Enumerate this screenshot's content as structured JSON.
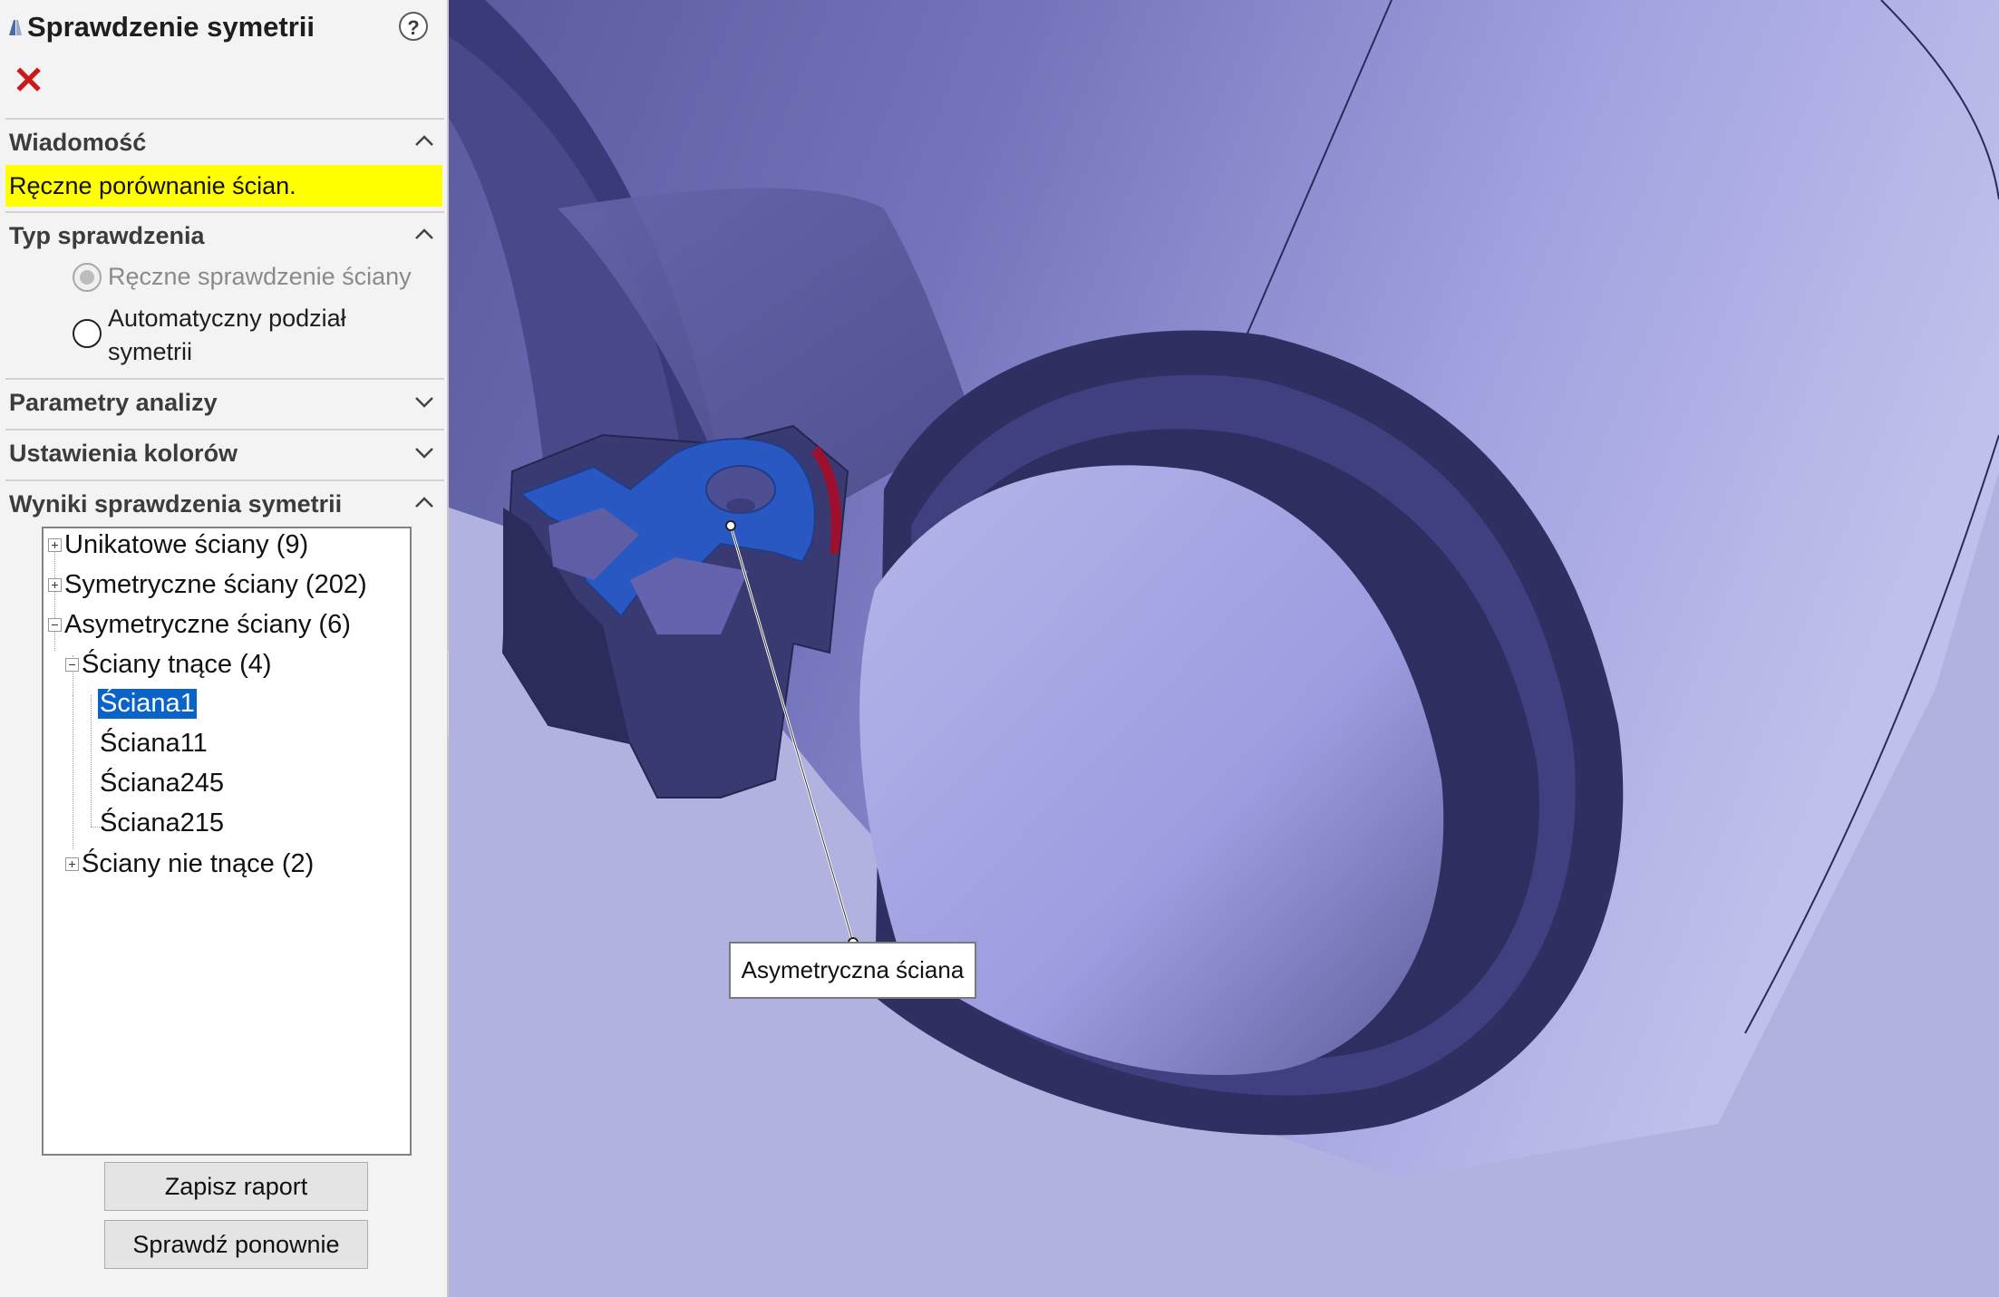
{
  "panel": {
    "title": "Sprawdzenie symetrii",
    "help_label": "?",
    "close_label": "✕",
    "sections": {
      "message": {
        "title": "Wiadomość",
        "text": "Ręczne porównanie ścian."
      },
      "check_type": {
        "title": "Typ sprawdzenia",
        "options": [
          {
            "label": "Ręczne sprawdzenie ściany",
            "selected": true,
            "enabled": false
          },
          {
            "label_line1": "Automatyczny podział",
            "label_line2": "symetrii",
            "selected": false,
            "enabled": true
          }
        ]
      },
      "analysis_params": {
        "title": "Parametry analizy"
      },
      "color_settings": {
        "title": "Ustawienia kolorów"
      },
      "results": {
        "title": "Wyniki sprawdzenia symetrii",
        "tree": [
          {
            "label": "Unikatowe ściany (9)",
            "expanded": false
          },
          {
            "label": "Symetryczne ściany (202)",
            "expanded": false
          },
          {
            "label": "Asymetryczne ściany (6)",
            "expanded": true,
            "children": [
              {
                "label": "Ściany tnące (4)",
                "expanded": true,
                "children": [
                  "Ściana1",
                  "Ściana11",
                  "Ściana245",
                  "Ściana215"
                ]
              },
              {
                "label": "Ściany nie tnące (2)",
                "expanded": false
              }
            ]
          }
        ],
        "selected_item": "Ściana1"
      }
    },
    "buttons": {
      "save_report": "Zapisz raport",
      "recheck": "Sprawdź ponownie"
    }
  },
  "viewport": {
    "callout_text": "Asymetryczna ściana"
  },
  "colors": {
    "highlight_yellow": "#ffff00",
    "selection_blue": "#0a64c8",
    "asymmetric_face": "#2a58c2",
    "cut_face": "#9c0f2f",
    "model_dark": "#2f2f62",
    "background": "#b2b2e0"
  }
}
